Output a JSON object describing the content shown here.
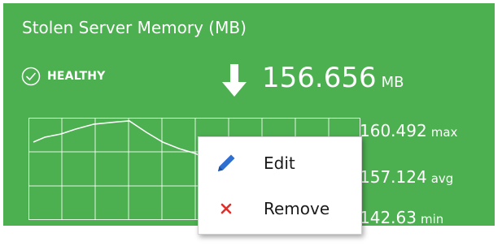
{
  "colors": {
    "tile_background": "#4caf50",
    "text": "#ffffff",
    "menu_background": "#ffffff",
    "edit_icon": "#2f6fd1",
    "remove_icon": "#e0302a"
  },
  "widget": {
    "title": "Stolen Server Memory (MB)",
    "status": {
      "icon": "check-circle-icon",
      "label": "HEALTHY"
    },
    "trend_icon": "arrow-down-icon",
    "current": {
      "value": "156.656",
      "unit": "MB"
    },
    "stats": {
      "max": {
        "value": "160.492",
        "label": "max"
      },
      "avg": {
        "value": "157.124",
        "label": "avg"
      },
      "min": {
        "value": "142.63",
        "label": "min"
      }
    }
  },
  "context_menu": {
    "items": [
      {
        "label": "Edit",
        "icon": "pencil-icon"
      },
      {
        "label": "Remove",
        "icon": "x-icon"
      }
    ]
  }
}
